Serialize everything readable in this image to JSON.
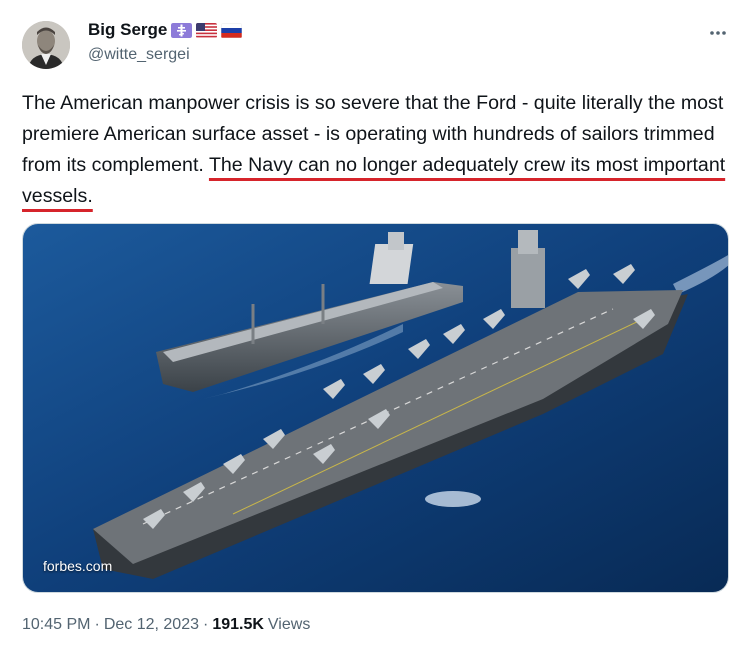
{
  "author": {
    "display_name": "Big Serge",
    "handle": "@witte_sergei",
    "badges": [
      "orthodox-cross-icon",
      "us-flag-icon",
      "russia-flag-icon"
    ]
  },
  "tweet": {
    "text_plain": "The American manpower crisis is so severe that the Ford - quite literally the most premiere American surface asset - is operating with hundreds of sailors trimmed from its complement.",
    "text_highlighted": "The Navy can no longer adequately crew its most important vessels.",
    "media_watermark": "forbes.com"
  },
  "meta": {
    "time": "10:45 PM",
    "separator": "·",
    "date": "Dec 12, 2023",
    "views_count": "191.5K",
    "views_label": "Views"
  },
  "colors": {
    "text": "#0f1419",
    "secondary": "#536471",
    "underline_red": "#d6242b",
    "ocean": "#0f3f7a"
  }
}
